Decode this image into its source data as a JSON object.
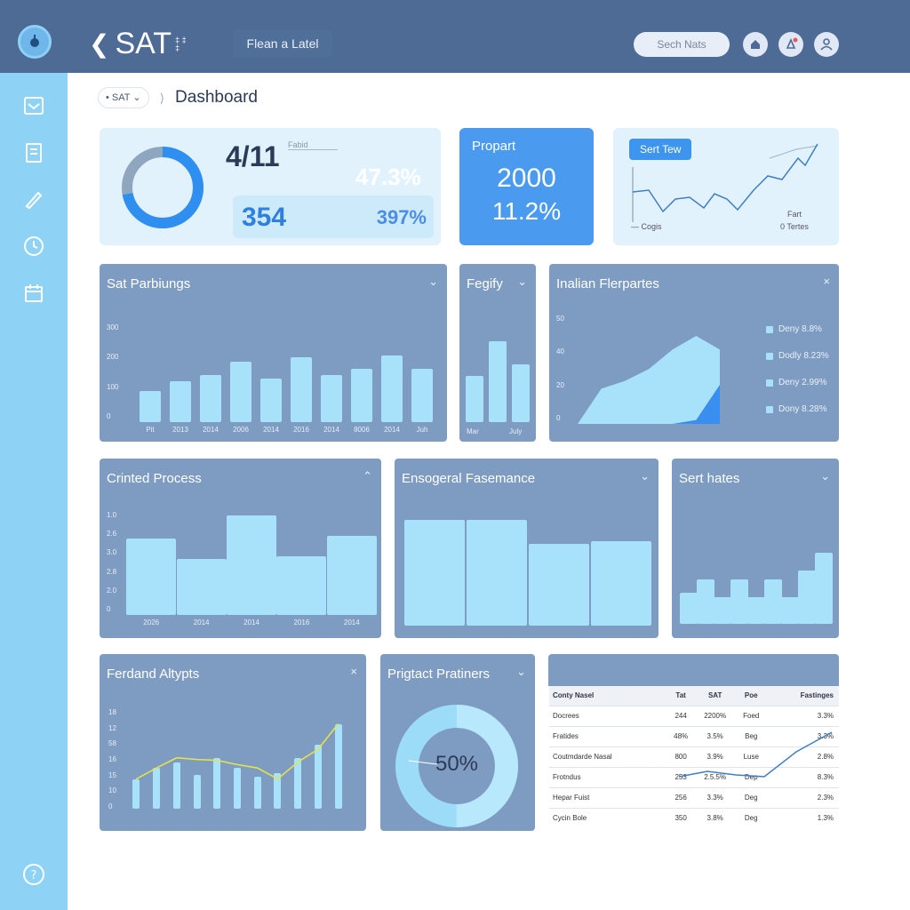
{
  "header": {
    "app_title": "SAT",
    "title_suffix": "‡ ‡ ‡",
    "link_label": "Flean a Latel",
    "search_placeholder": "Sech Nats",
    "icons": [
      "logo-icon",
      "home-icon",
      "notification-icon",
      "user-icon"
    ]
  },
  "sidebar": {
    "icons": [
      "inbox-icon",
      "document-icon",
      "pen-icon",
      "clock-icon",
      "calendar-icon",
      "help-icon"
    ]
  },
  "breadcrumb": {
    "selector": "• SAT ⌄",
    "separator": "⟩",
    "page": "Dashboard"
  },
  "stats": {
    "ratio": "4/11",
    "ratio_note": "Fabid",
    "pct_top": "47.3%",
    "count": "354",
    "pct_bottom": "397%",
    "donut_fraction": 0.72
  },
  "project_card": {
    "title": "Propart",
    "value": "2000",
    "pct": "11.2%"
  },
  "trend_card": {
    "button": "Sert Tew",
    "legend_left": "— Cogis",
    "legend_right_1": "Fart",
    "legend_right_2": "0 Tertes"
  },
  "panel1": {
    "title": "Sat Parbiungs",
    "ylabels": [
      "300",
      "200",
      "100",
      "0"
    ],
    "xlabels": [
      "Pit",
      "2013",
      "2014",
      "2006",
      "2014",
      "2016",
      "2014",
      "8006",
      "2014",
      "Juh"
    ],
    "chart_data": {
      "type": "bar",
      "categories": [
        "Pit",
        "2013",
        "2014",
        "2006",
        "2014",
        "2016",
        "2014",
        "8006",
        "2014",
        "Juh"
      ],
      "values": [
        95,
        125,
        145,
        185,
        135,
        200,
        145,
        165,
        205,
        165
      ],
      "ylim": [
        0,
        300
      ]
    }
  },
  "panel2": {
    "title": "Fegify",
    "xlabels": [
      "Mar",
      "July"
    ],
    "chart_data": {
      "type": "bar",
      "categories": [
        "Mar",
        "",
        "July"
      ],
      "values": [
        40,
        70,
        50
      ],
      "ylim": [
        0,
        100
      ]
    }
  },
  "panel3": {
    "title": "Inalian Flerpartes",
    "ylabels": [
      "50",
      "40",
      "20",
      "0"
    ],
    "legend": [
      "Deny 8.8%",
      "Dodly 8.23%",
      "Deny 2.99%",
      "Dony 8.28%"
    ],
    "chart_data": {
      "type": "area",
      "x": [
        0,
        1,
        2,
        3,
        4,
        5,
        6
      ],
      "series": [
        {
          "values": [
            0,
            18,
            22,
            28,
            38,
            45,
            38
          ]
        },
        {
          "values": [
            0,
            0,
            0,
            0,
            0,
            2,
            20
          ]
        }
      ],
      "ylim": [
        0,
        50
      ]
    }
  },
  "panel4": {
    "title": "Crinted Process",
    "ylabels": [
      "1.0",
      "2.6",
      "3.0",
      "2.8",
      "2.0",
      "0"
    ],
    "xlabels": [
      "2026",
      "2014",
      "2014",
      "2016",
      "2014"
    ],
    "chart_data": {
      "type": "bar",
      "categories": [
        "2026",
        "2014",
        "2014",
        "2016",
        "2014"
      ],
      "values": [
        0.85,
        0.62,
        1.1,
        0.65,
        0.88
      ],
      "ylim": [
        0,
        1.2
      ]
    }
  },
  "panel5": {
    "title": "Ensogeral Fasemance",
    "chart_data": {
      "type": "bar",
      "categories": [
        "",
        "",
        "",
        ""
      ],
      "values": [
        90,
        90,
        70,
        72
      ],
      "ylim": [
        0,
        100
      ]
    }
  },
  "panel6": {
    "title": "Sert hates",
    "chart_data": {
      "type": "bar",
      "categories": [
        "",
        "",
        "",
        "",
        "",
        "",
        "",
        "",
        ""
      ],
      "values": [
        35,
        50,
        30,
        50,
        30,
        50,
        30,
        60,
        80
      ],
      "ylim": [
        0,
        100
      ]
    }
  },
  "panel7": {
    "title": "Ferdand Altypts",
    "ylabels": [
      "18",
      "12",
      "58",
      "16",
      "15",
      "10",
      "0"
    ],
    "chart_data": {
      "type": "bar",
      "values": [
        35,
        48,
        55,
        40,
        60,
        48,
        38,
        42,
        60,
        75,
        100
      ],
      "line": [
        35,
        48,
        60,
        58,
        57,
        52,
        48,
        35,
        55,
        70,
        100
      ],
      "ylim": [
        0,
        110
      ]
    }
  },
  "panel8": {
    "title": "Prigtact Pratiners",
    "donut_label": "50%",
    "chart_data": {
      "type": "pie",
      "values": [
        50,
        50
      ]
    }
  },
  "table": {
    "headers": [
      "Conty Nasel",
      "Tat",
      "SAT",
      "Poe",
      "Fastinges"
    ],
    "rows": [
      [
        "Docrees",
        "244",
        "2200%",
        "Foed",
        "3.3%"
      ],
      [
        "Fratides",
        "48%",
        "3.5%",
        "Beg",
        "3.3%"
      ],
      [
        "Coutmdarde Nasal",
        "800",
        "3.9%",
        "Luse",
        "2.8%"
      ],
      [
        "Frotndus",
        "253",
        "2.5.5%",
        "Dep",
        "8.3%"
      ],
      [
        "Hepar Fuist",
        "256",
        "3.3%",
        "Deg",
        "2.3%"
      ],
      [
        "Cycin Bole",
        "350",
        "3.8%",
        "Deg",
        "1.3%"
      ]
    ],
    "sparkline": [
      0,
      1,
      0,
      0,
      4,
      9
    ]
  }
}
